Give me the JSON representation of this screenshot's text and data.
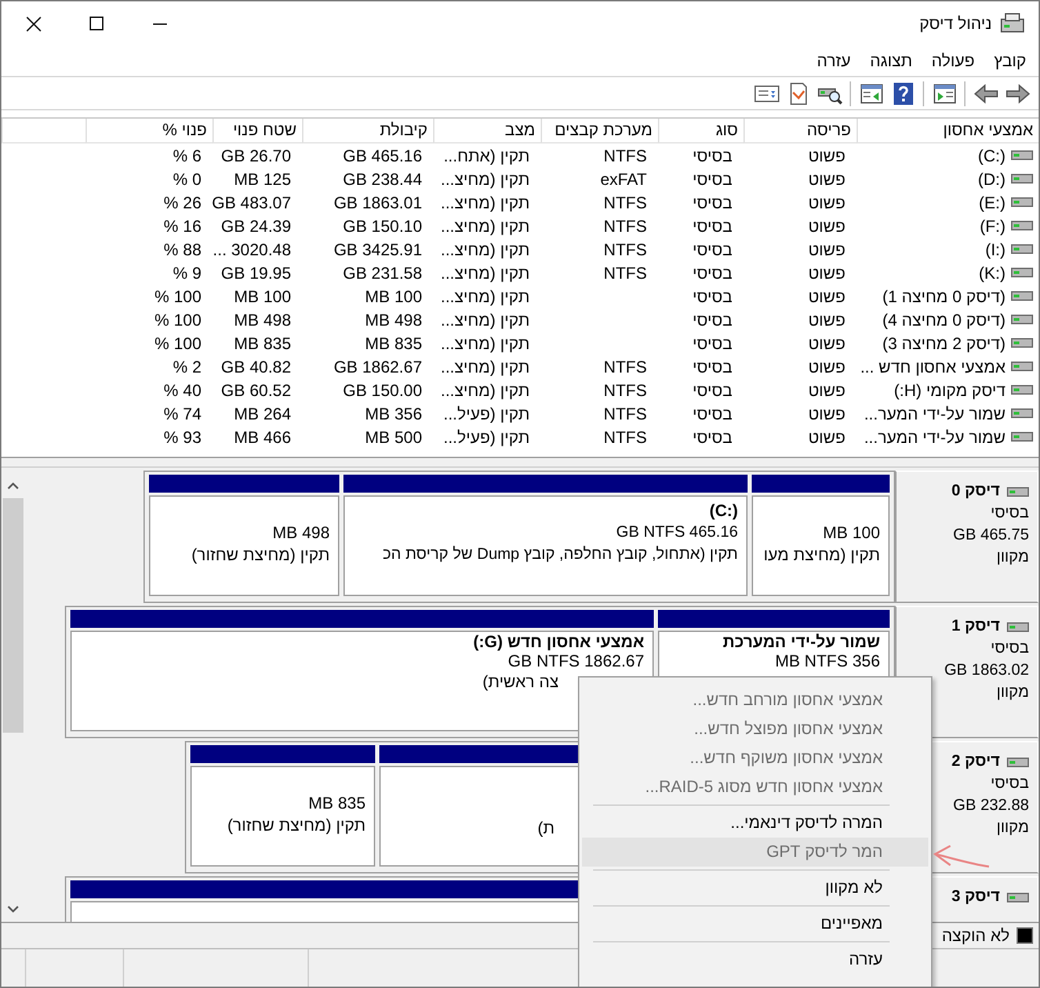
{
  "window": {
    "title": "ניהול דיסק"
  },
  "menu": [
    "קובץ",
    "פעולה",
    "תצוגה",
    "עזרה"
  ],
  "volume_table": {
    "columns": [
      "אמצעי אחסון",
      "פריסה",
      "סוג",
      "מערכת קבצים",
      "מצב",
      "קיבולת",
      "שטח פנוי",
      "פנוי %"
    ],
    "rows": [
      {
        "volume": "(C:)",
        "layout": "פשוט",
        "type": "בסיסי",
        "file_system": "NTFS",
        "status": "תקין (אתח...",
        "capacity": "GB 465.16",
        "free_space": "GB 26.70",
        "percent_free": "% 6"
      },
      {
        "volume": "(D:)",
        "layout": "פשוט",
        "type": "בסיסי",
        "file_system": "exFAT",
        "status": "תקין (מחיצ...",
        "capacity": "GB 238.44",
        "free_space": "MB 125",
        "percent_free": "% 0"
      },
      {
        "volume": "(E:)",
        "layout": "פשוט",
        "type": "בסיסי",
        "file_system": "NTFS",
        "status": "תקין (מחיצ...",
        "capacity": "GB 1863.01",
        "free_space": "GB 483.07",
        "percent_free": "% 26"
      },
      {
        "volume": "(F:)",
        "layout": "פשוט",
        "type": "בסיסי",
        "file_system": "NTFS",
        "status": "תקין (מחיצ...",
        "capacity": "GB 150.10",
        "free_space": "GB 24.39",
        "percent_free": "% 16"
      },
      {
        "volume": "(I:)",
        "layout": "פשוט",
        "type": "בסיסי",
        "file_system": "NTFS",
        "status": "תקין (מחיצ...",
        "capacity": "GB 3425.91",
        "free_space": "... 3020.48",
        "percent_free": "% 88"
      },
      {
        "volume": "(K:)",
        "layout": "פשוט",
        "type": "בסיסי",
        "file_system": "NTFS",
        "status": "תקין (מחיצ...",
        "capacity": "GB 231.58",
        "free_space": "GB 19.95",
        "percent_free": "% 9"
      },
      {
        "volume": "(דיסק 0 מחיצה 1)",
        "layout": "פשוט",
        "type": "בסיסי",
        "status": "תקין (מחיצ...",
        "capacity": "MB 100",
        "free_space": "MB 100",
        "percent_free": "% 100"
      },
      {
        "volume": "(דיסק 0 מחיצה 4)",
        "layout": "פשוט",
        "type": "בסיסי",
        "status": "תקין (מחיצ...",
        "capacity": "MB 498",
        "free_space": "MB 498",
        "percent_free": "% 100"
      },
      {
        "volume": "(דיסק 2 מחיצה 3)",
        "layout": "פשוט",
        "type": "בסיסי",
        "status": "תקין (מחיצ...",
        "capacity": "MB 835",
        "free_space": "MB 835",
        "percent_free": "% 100"
      },
      {
        "volume": "אמצעי אחסון חדש ...",
        "layout": "פשוט",
        "type": "בסיסי",
        "file_system": "NTFS",
        "status": "תקין (מחיצ...",
        "capacity": "GB 1862.67",
        "free_space": "GB 40.82",
        "percent_free": "% 2"
      },
      {
        "volume": "דיסק מקומי (H:)",
        "layout": "פשוט",
        "type": "בסיסי",
        "file_system": "NTFS",
        "status": "תקין (מחיצ...",
        "capacity": "GB 150.00",
        "free_space": "GB 60.52",
        "percent_free": "% 40"
      },
      {
        "volume": "שמור על-ידי המער...",
        "layout": "פשוט",
        "type": "בסיסי",
        "file_system": "NTFS",
        "status": "תקין (פעיל...",
        "capacity": "MB 356",
        "free_space": "MB 264",
        "percent_free": "% 74"
      },
      {
        "volume": "שמור על-ידי המער...",
        "layout": "פשוט",
        "type": "בסיסי",
        "file_system": "NTFS",
        "status": "תקין (פעיל...",
        "capacity": "MB 500",
        "free_space": "MB 466",
        "percent_free": "% 93"
      }
    ]
  },
  "disks": [
    {
      "name": "דיסק 0",
      "type": "בסיסי",
      "size": "GB 465.75",
      "status": "מקוון",
      "partitions": [
        {
          "kind": "volume",
          "lines": [
            "MB 100",
            "תקין (מחיצת מעו"
          ]
        },
        {
          "kind": "volume",
          "title": "(C:)",
          "lines": [
            "GB NTFS 465.16",
            "תקין (אתחול, קובץ החלפה, קובץ Dump של קריסת הכ"
          ]
        },
        {
          "kind": "volume",
          "lines": [
            "MB 498",
            "תקין (מחיצת שחזור)"
          ]
        }
      ]
    },
    {
      "name": "דיסק 1",
      "type": "בסיסי",
      "size": "GB 1863.02",
      "status": "מקוון",
      "partitions": [
        {
          "kind": "volume",
          "title": "שמור על-ידי המערכת",
          "lines": [
            "MB NTFS 356"
          ]
        },
        {
          "kind": "volume",
          "title": "אמצעי אחסון חדש (G:)",
          "lines": [
            "GB NTFS 1862.67",
            "צה ראשית)"
          ]
        }
      ]
    },
    {
      "name": "דיסק 2",
      "type": "בסיסי",
      "size": "GB 232.88",
      "status": "מקוון",
      "partitions": [
        {
          "kind": "volume",
          "lines": [
            "ת)"
          ]
        },
        {
          "kind": "volume",
          "lines": [
            "MB 835",
            "תקין (מחיצת שחזור)"
          ]
        }
      ]
    },
    {
      "name": "דיסק 3",
      "partitions": [
        {
          "kind": "volume"
        }
      ]
    }
  ],
  "legend": [
    {
      "label": "לא הוקצה",
      "color": "#000000"
    }
  ],
  "context_menu": {
    "groups": [
      {
        "items": [
          {
            "label": "אמצעי אחסון מורחב חדש...",
            "disabled": true,
            "selected": false
          },
          {
            "label": "אמצעי אחסון מפוצל חדש...",
            "disabled": true,
            "selected": false
          },
          {
            "label": "אמצעי אחסון משוקף חדש...",
            "disabled": true,
            "selected": false
          },
          {
            "label": "אמצעי אחסון חדש מסוג RAID-5...",
            "disabled": true,
            "selected": false
          }
        ]
      },
      {
        "items": [
          {
            "label": "המרה לדיסק דינאמי...",
            "disabled": false,
            "selected": false
          },
          {
            "label": "המר לדיסק GPT",
            "disabled": true,
            "selected": true
          }
        ]
      },
      {
        "items": [
          {
            "label": "לא מקוון",
            "disabled": false,
            "selected": false
          }
        ]
      },
      {
        "items": [
          {
            "label": "מאפיינים",
            "disabled": false,
            "selected": false
          }
        ]
      },
      {
        "items": [
          {
            "label": "עזרה",
            "disabled": false,
            "selected": false
          }
        ]
      }
    ]
  }
}
